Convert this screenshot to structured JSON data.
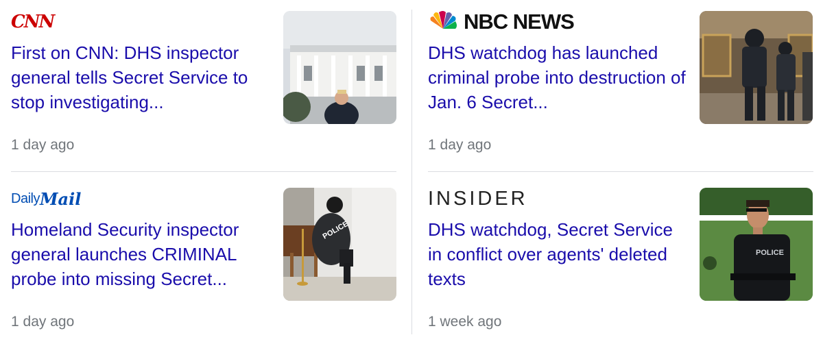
{
  "cards": [
    {
      "source": "CNN",
      "headline": "First on CNN: DHS inspector general tells Secret Service to stop investigating...",
      "time": "1 day ago"
    },
    {
      "source": "NBC NEWS",
      "headline": "DHS watchdog has launched criminal probe into destruction of Jan. 6 Secret...",
      "time": "1 day ago"
    },
    {
      "source_part1": "Daily",
      "source_part2": "Mail",
      "headline": "Homeland Security inspector general launches CRIMINAL probe into missing Secret...",
      "time": "1 day ago"
    },
    {
      "source": "INSIDER",
      "headline": "DHS watchdog, Secret Service in conflict over agents' deleted texts",
      "time": "1 week ago"
    }
  ],
  "colors": {
    "headline": "#1a0dab",
    "time": "#70757a",
    "cnn_red": "#cc0000",
    "daily_mail_blue": "#004db3",
    "divider": "#dadce0"
  },
  "icons": [
    "nbc-peacock-icon"
  ]
}
